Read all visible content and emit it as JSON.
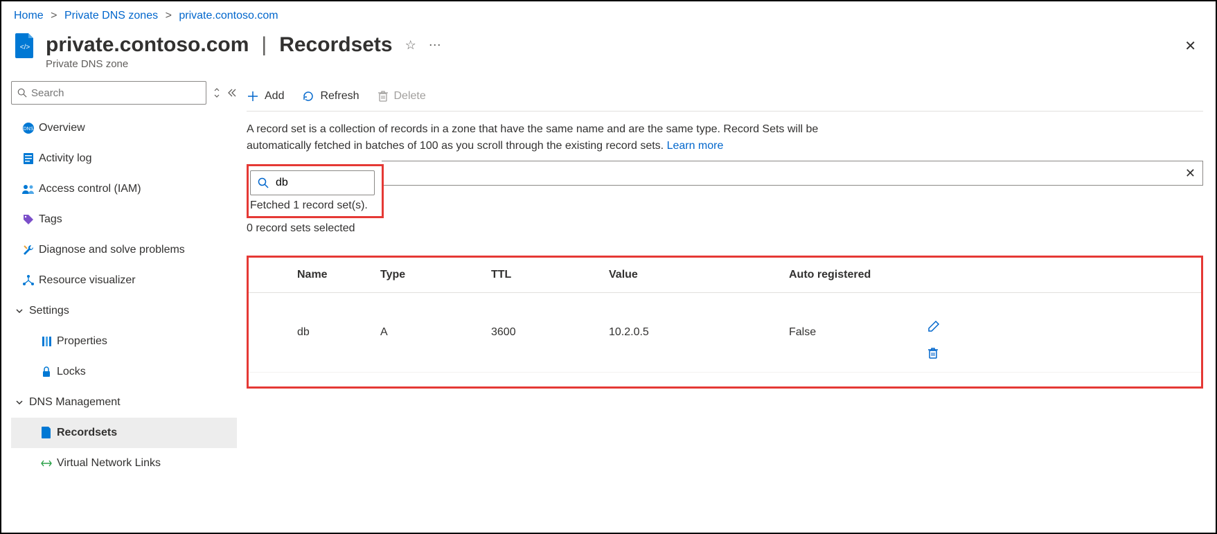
{
  "breadcrumb": {
    "home": "Home",
    "zones": "Private DNS zones",
    "zone": "private.contoso.com"
  },
  "header": {
    "title": "private.contoso.com",
    "section": "Recordsets",
    "subtitle": "Private DNS zone"
  },
  "sidebar": {
    "search_placeholder": "Search",
    "items": {
      "overview": "Overview",
      "activity": "Activity log",
      "iam": "Access control (IAM)",
      "tags": "Tags",
      "diagnose": "Diagnose and solve problems",
      "visualizer": "Resource visualizer"
    },
    "groups": {
      "settings": "Settings",
      "properties": "Properties",
      "locks": "Locks",
      "dns": "DNS Management",
      "recordsets": "Recordsets",
      "vnl": "Virtual Network Links"
    }
  },
  "toolbar": {
    "add": "Add",
    "refresh": "Refresh",
    "delete": "Delete"
  },
  "description": {
    "text": "A record set is a collection of records in a zone that have the same name and are the same type. Record Sets will be automatically fetched in batches of 100 as you scroll through the existing record sets. ",
    "link": "Learn more"
  },
  "search": {
    "value": "db",
    "fetched": "Fetched 1 record set(s).",
    "selected": "0 record sets selected"
  },
  "table": {
    "headers": {
      "name": "Name",
      "type": "Type",
      "ttl": "TTL",
      "value": "Value",
      "auto": "Auto registered"
    },
    "rows": [
      {
        "name": "db",
        "type": "A",
        "ttl": "3600",
        "value": "10.2.0.5",
        "auto": "False"
      }
    ]
  }
}
